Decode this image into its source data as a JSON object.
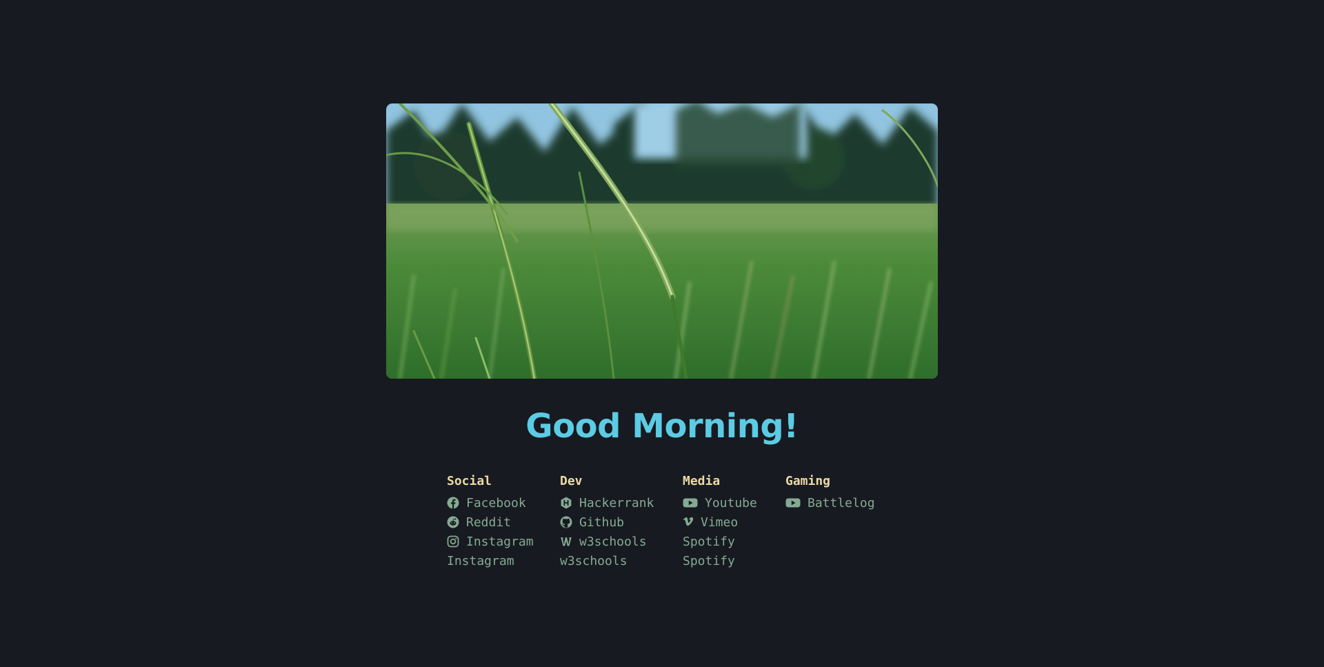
{
  "greeting": "Good Morning!",
  "colors": {
    "background": "#171a20",
    "greeting": "#5ccbe4",
    "heading": "#ecd9a5",
    "link": "#86aa93"
  },
  "hero_image": {
    "icon": "grass-field-photo"
  },
  "columns": {
    "social": {
      "title": "Social",
      "links": [
        {
          "label": "Facebook",
          "icon": "facebook-icon"
        },
        {
          "label": "Reddit",
          "icon": "reddit-icon"
        },
        {
          "label": "Instagram",
          "icon": "instagram-icon"
        },
        {
          "label": "Instagram"
        }
      ]
    },
    "dev": {
      "title": "Dev",
      "links": [
        {
          "label": "Hackerrank",
          "icon": "hackerrank-icon"
        },
        {
          "label": "Github",
          "icon": "github-icon"
        },
        {
          "label": "w3schools",
          "icon": "w3schools-icon"
        },
        {
          "label": "w3schools"
        }
      ]
    },
    "media": {
      "title": "Media",
      "links": [
        {
          "label": "Youtube",
          "icon": "youtube-icon"
        },
        {
          "label": "Vimeo",
          "icon": "vimeo-icon"
        },
        {
          "label": "Spotify"
        },
        {
          "label": "Spotify"
        }
      ]
    },
    "gaming": {
      "title": "Gaming",
      "links": [
        {
          "label": "Battlelog",
          "icon": "youtube-icon"
        }
      ]
    }
  }
}
